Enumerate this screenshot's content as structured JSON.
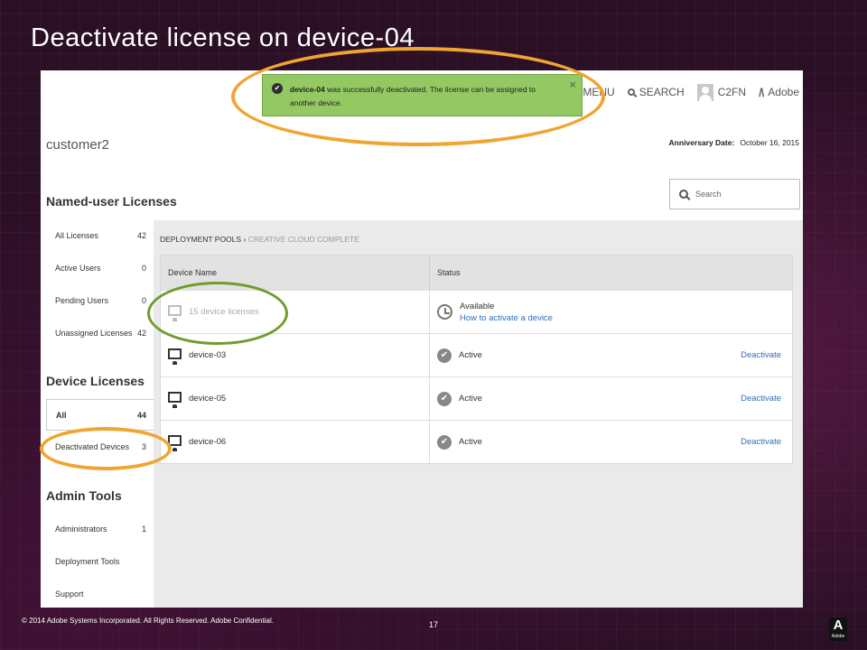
{
  "slide": {
    "title": "Deactivate license on device-04",
    "copyright": "© 2014 Adobe Systems Incorporated.  All Rights Reserved.  Adobe Confidential.",
    "page_number": "17",
    "logo_text": "Adobe"
  },
  "topnav": {
    "menu": "MENU",
    "search": "SEARCH",
    "user": "C2FN",
    "brand": "Adobe"
  },
  "toast": {
    "device": "device-04",
    "message": " was successfully deactivated. The license can be assigned to another device.",
    "close": "×"
  },
  "org": {
    "name": "customer2",
    "anniversary_label": "Anniversary Date:",
    "anniversary_value": "October 16, 2015"
  },
  "search": {
    "placeholder": "Search"
  },
  "sidebar": {
    "named_heading": "Named-user Licenses",
    "named_items": [
      {
        "label": "All Licenses",
        "count": "42"
      },
      {
        "label": "Active Users",
        "count": "0"
      },
      {
        "label": "Pending Users",
        "count": "0"
      },
      {
        "label": "Unassigned Licenses",
        "count": "42"
      }
    ],
    "device_heading": "Device Licenses",
    "device_items": [
      {
        "label": "All",
        "count": "44"
      },
      {
        "label": "Deactivated Devices",
        "count": "3"
      }
    ],
    "admin_heading": "Admin Tools",
    "admin_items": [
      {
        "label": "Administrators",
        "count": "1"
      },
      {
        "label": "Deployment Tools",
        "count": ""
      },
      {
        "label": "Support",
        "count": ""
      }
    ]
  },
  "breadcrumb": {
    "root": "DEPLOYMENT POOLS",
    "separator": " › ",
    "current": "CREATIVE CLOUD COMPLETE"
  },
  "table": {
    "headers": [
      "Device Name",
      "Status"
    ],
    "pool_row": {
      "name": "15 device licenses",
      "status": "Available",
      "link": "How to activate a device"
    },
    "rows": [
      {
        "name": "device-03",
        "status": "Active",
        "action": "Deactivate"
      },
      {
        "name": "device-05",
        "status": "Active",
        "action": "Deactivate"
      },
      {
        "name": "device-06",
        "status": "Active",
        "action": "Deactivate"
      }
    ]
  },
  "colors": {
    "toast_bg": "#93c862",
    "highlight_orange": "#f0a531",
    "highlight_green": "#6f9c2b",
    "link": "#2d6fba"
  },
  "icons": [
    "menu-icon",
    "search-icon",
    "user-avatar-icon",
    "adobe-logo-icon",
    "check-circle-icon",
    "close-icon",
    "monitor-icon",
    "clock-icon"
  ]
}
